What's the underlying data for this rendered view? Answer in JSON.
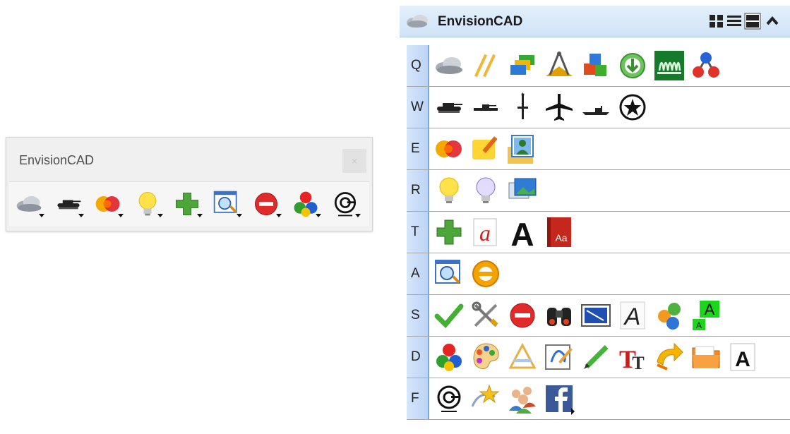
{
  "toolbox": {
    "title": "EnvisionCAD",
    "close_label": "×",
    "buttons": [
      {
        "name": "cloud-icon"
      },
      {
        "name": "tank-icon"
      },
      {
        "name": "overlap-circles-icon"
      },
      {
        "name": "lightbulb-icon"
      },
      {
        "name": "green-cross-icon"
      },
      {
        "name": "magnifier-window-icon"
      },
      {
        "name": "no-entry-icon"
      },
      {
        "name": "color-balls-icon"
      },
      {
        "name": "at-target-icon"
      }
    ]
  },
  "panel": {
    "title": "EnvisionCAD",
    "controls": [
      "grid-view-icon",
      "list-view-icon",
      "large-view-icon",
      "collapse-icon"
    ],
    "rows": [
      {
        "key": "Q",
        "icons": [
          "cloud-icon",
          "pencils-icon",
          "stacked-layers-icon",
          "compass-icon",
          "cubes-icon",
          "download-arrow-icon",
          "wiring-icon",
          "network-nodes-icon"
        ]
      },
      {
        "key": "W",
        "icons": [
          "tank-icon",
          "boat-icon",
          "missile-icon",
          "airplane-icon",
          "ship-icon",
          "star-circle-icon"
        ]
      },
      {
        "key": "E",
        "icons": [
          "overlap-circles-icon",
          "note-pencil-icon",
          "image-person-icon"
        ]
      },
      {
        "key": "R",
        "icons": [
          "lightbulb-yellow-icon",
          "lightbulb-purple-icon",
          "photos-icon"
        ]
      },
      {
        "key": "T",
        "icons": [
          "green-cross-icon",
          "italic-a-icon",
          "bold-a-icon",
          "font-book-icon"
        ]
      },
      {
        "key": "A",
        "icons": [
          "magnifier-window-icon",
          "refresh-orange-icon"
        ]
      },
      {
        "key": "S",
        "icons": [
          "checkmark-icon",
          "tools-icon",
          "no-entry-icon",
          "binoculars-icon",
          "picture-frame-icon",
          "italic-a-outline-icon",
          "circles-person-icon",
          "green-text-a-icon"
        ]
      },
      {
        "key": "D",
        "icons": [
          "color-balls-icon",
          "palette-icon",
          "triangle-ruler-icon",
          "pen-frame-icon",
          "green-pencil-icon",
          "tt-text-icon",
          "yellow-arrow-icon",
          "orange-folder-icon",
          "bold-a-box-icon"
        ]
      },
      {
        "key": "F",
        "icons": [
          "at-target-icon",
          "star-swoosh-icon",
          "users-group-icon",
          "facebook-icon"
        ]
      }
    ]
  }
}
